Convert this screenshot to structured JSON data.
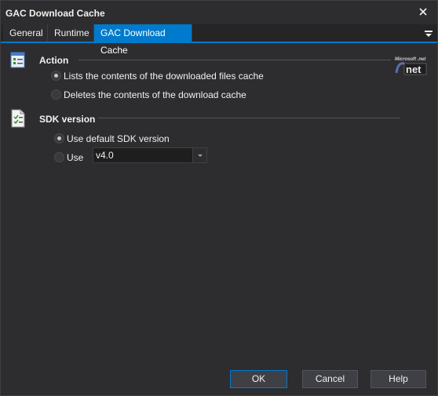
{
  "window": {
    "title": "GAC Download Cache"
  },
  "tabs": [
    {
      "label": "General"
    },
    {
      "label": "Runtime"
    },
    {
      "label": "GAC Download Cache",
      "active": true
    }
  ],
  "action": {
    "title": "Action",
    "options": [
      {
        "label": "Lists the contents of the downloaded files cache",
        "selected": true
      },
      {
        "label": "Deletes the contents of the download cache",
        "selected": false
      }
    ]
  },
  "sdk": {
    "title": "SDK version",
    "options": [
      {
        "label": "Use default SDK version",
        "selected": true
      },
      {
        "label": "Use",
        "selected": false
      }
    ],
    "version_value": "v4.0"
  },
  "logo": {
    "text": "Microsoft .net"
  },
  "buttons": {
    "ok": "OK",
    "cancel": "Cancel",
    "help": "Help"
  },
  "colors": {
    "accent": "#007acc",
    "background": "#2d2d30",
    "tabbar": "#252526"
  }
}
